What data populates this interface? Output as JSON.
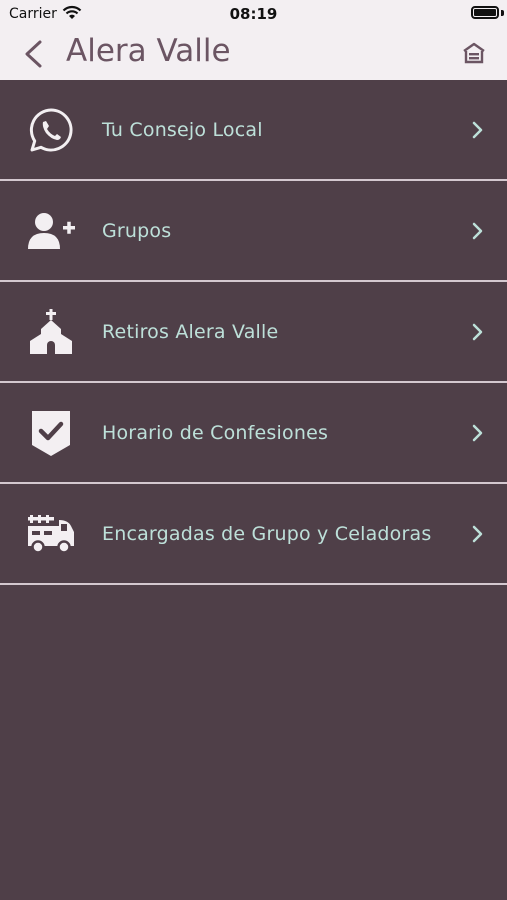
{
  "status_bar": {
    "carrier": "Carrier",
    "time": "08:19"
  },
  "nav": {
    "title": "Alera Valle",
    "back_icon": "chevron-left-icon",
    "home_icon": "home-icon"
  },
  "colors": {
    "background": "#4f3f48",
    "header": "#f3eff2",
    "label": "#bde0d9",
    "title": "#6b5563",
    "divider": "#d4c8cf"
  },
  "menu": {
    "items": [
      {
        "label": "Tu Consejo Local",
        "icon": "whatsapp-icon"
      },
      {
        "label": "Grupos",
        "icon": "add-user-icon"
      },
      {
        "label": "Retiros Alera Valle",
        "icon": "church-icon"
      },
      {
        "label": "Horario de Confesiones",
        "icon": "shield-check-icon"
      },
      {
        "label": "Encargadas de Grupo y Celadoras",
        "icon": "fire-truck-icon"
      }
    ]
  }
}
